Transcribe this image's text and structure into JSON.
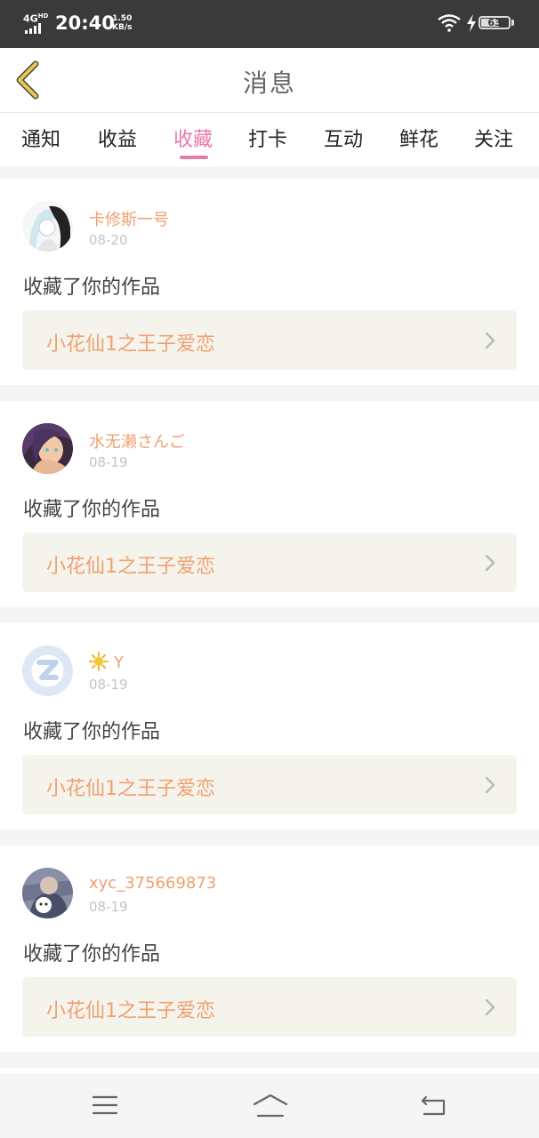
{
  "status_bar": {
    "network": "4G",
    "network_sup": "HD",
    "time": "20:40",
    "speed_value": "1.50",
    "speed_unit": "KB/s",
    "battery": "63"
  },
  "header": {
    "title": "消息",
    "back_icon": "chevron-left-icon"
  },
  "tabs": [
    {
      "label": "通知"
    },
    {
      "label": "收益"
    },
    {
      "label": "收藏",
      "active": true
    },
    {
      "label": "打卡"
    },
    {
      "label": "互动"
    },
    {
      "label": "鲜花"
    },
    {
      "label": "关注"
    }
  ],
  "notifications": [
    {
      "username": "卡修斯一号",
      "date": "08-20",
      "action": "收藏了你的作品",
      "work_title": "小花仙1之王子爱恋"
    },
    {
      "username": "水无濑さんご",
      "date": "08-19",
      "action": "收藏了你的作品",
      "work_title": "小花仙1之王子爱恋"
    },
    {
      "username": "Y",
      "date": "08-19",
      "action": "收藏了你的作品",
      "work_title": "小花仙1之王子爱恋"
    },
    {
      "username": "xyc_375669873",
      "date": "08-19",
      "action": "收藏了你的作品",
      "work_title": "小花仙1之王子爱恋"
    }
  ],
  "colors": {
    "accent": "#e879a8",
    "username": "#f0a070",
    "back_icon": "#e9c84a",
    "work_box_bg": "#f5f4ec"
  },
  "system_nav": {
    "menu_icon": "menu-icon",
    "home_icon": "home-icon",
    "back_icon": "back-arrow-icon"
  }
}
